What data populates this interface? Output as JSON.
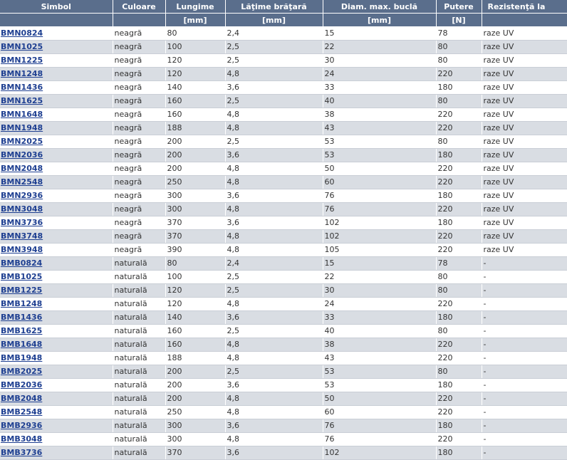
{
  "headers": {
    "simbol": "Simbol",
    "culoare": "Culoare",
    "lungime": "Lungime",
    "latime": "Lăţime brăţară",
    "diam": "Diam. max. buclă",
    "putere": "Putere",
    "rezistenta": "Rezistenţă la"
  },
  "units": {
    "simbol": "",
    "culoare": "",
    "lungime": "[mm]",
    "latime": "[mm]",
    "diam": "[mm]",
    "putere": "[N]",
    "rezistenta": ""
  },
  "rows": [
    {
      "simbol": "BMN0824",
      "culoare": "neagră",
      "lungime": "80",
      "latime": "2,4",
      "diam": "15",
      "putere": "78",
      "rezistenta": "raze UV"
    },
    {
      "simbol": "BMN1025",
      "culoare": "neagră",
      "lungime": "100",
      "latime": "2,5",
      "diam": "22",
      "putere": "80",
      "rezistenta": "raze UV"
    },
    {
      "simbol": "BMN1225",
      "culoare": "neagră",
      "lungime": "120",
      "latime": "2,5",
      "diam": "30",
      "putere": "80",
      "rezistenta": "raze UV"
    },
    {
      "simbol": "BMN1248",
      "culoare": "neagră",
      "lungime": "120",
      "latime": "4,8",
      "diam": "24",
      "putere": "220",
      "rezistenta": "raze UV"
    },
    {
      "simbol": "BMN1436",
      "culoare": "neagră",
      "lungime": "140",
      "latime": "3,6",
      "diam": "33",
      "putere": "180",
      "rezistenta": "raze UV"
    },
    {
      "simbol": "BMN1625",
      "culoare": "neagră",
      "lungime": "160",
      "latime": "2,5",
      "diam": "40",
      "putere": "80",
      "rezistenta": "raze UV"
    },
    {
      "simbol": "BMN1648",
      "culoare": "neagră",
      "lungime": "160",
      "latime": "4,8",
      "diam": "38",
      "putere": "220",
      "rezistenta": "raze UV"
    },
    {
      "simbol": "BMN1948",
      "culoare": "neagră",
      "lungime": "188",
      "latime": "4,8",
      "diam": "43",
      "putere": "220",
      "rezistenta": "raze UV"
    },
    {
      "simbol": "BMN2025",
      "culoare": "neagră",
      "lungime": "200",
      "latime": "2,5",
      "diam": "53",
      "putere": "80",
      "rezistenta": "raze UV"
    },
    {
      "simbol": "BMN2036",
      "culoare": "neagră",
      "lungime": "200",
      "latime": "3,6",
      "diam": "53",
      "putere": "180",
      "rezistenta": "raze UV"
    },
    {
      "simbol": "BMN2048",
      "culoare": "neagră",
      "lungime": "200",
      "latime": "4,8",
      "diam": "50",
      "putere": "220",
      "rezistenta": "raze UV"
    },
    {
      "simbol": "BMN2548",
      "culoare": "neagră",
      "lungime": "250",
      "latime": "4,8",
      "diam": "60",
      "putere": "220",
      "rezistenta": "raze UV"
    },
    {
      "simbol": "BMN2936",
      "culoare": "neagră",
      "lungime": "300",
      "latime": "3,6",
      "diam": "76",
      "putere": "180",
      "rezistenta": "raze UV"
    },
    {
      "simbol": "BMN3048",
      "culoare": "neagră",
      "lungime": "300",
      "latime": "4,8",
      "diam": "76",
      "putere": "220",
      "rezistenta": "raze UV"
    },
    {
      "simbol": "BMN3736",
      "culoare": "neagră",
      "lungime": "370",
      "latime": "3,6",
      "diam": "102",
      "putere": "180",
      "rezistenta": "raze UV"
    },
    {
      "simbol": "BMN3748",
      "culoare": "neagră",
      "lungime": "370",
      "latime": "4,8",
      "diam": "102",
      "putere": "220",
      "rezistenta": "raze UV"
    },
    {
      "simbol": "BMN3948",
      "culoare": "neagră",
      "lungime": "390",
      "latime": "4,8",
      "diam": "105",
      "putere": "220",
      "rezistenta": "raze UV"
    },
    {
      "simbol": "BMB0824",
      "culoare": "naturală",
      "lungime": "80",
      "latime": "2,4",
      "diam": "15",
      "putere": "78",
      "rezistenta": "-"
    },
    {
      "simbol": "BMB1025",
      "culoare": "naturală",
      "lungime": "100",
      "latime": "2,5",
      "diam": "22",
      "putere": "80",
      "rezistenta": "-"
    },
    {
      "simbol": "BMB1225",
      "culoare": "naturală",
      "lungime": "120",
      "latime": "2,5",
      "diam": "30",
      "putere": "80",
      "rezistenta": "-"
    },
    {
      "simbol": "BMB1248",
      "culoare": "naturală",
      "lungime": "120",
      "latime": "4,8",
      "diam": "24",
      "putere": "220",
      "rezistenta": "-"
    },
    {
      "simbol": "BMB1436",
      "culoare": "naturală",
      "lungime": "140",
      "latime": "3,6",
      "diam": "33",
      "putere": "180",
      "rezistenta": "-"
    },
    {
      "simbol": "BMB1625",
      "culoare": "naturală",
      "lungime": "160",
      "latime": "2,5",
      "diam": "40",
      "putere": "80",
      "rezistenta": "-"
    },
    {
      "simbol": "BMB1648",
      "culoare": "naturală",
      "lungime": "160",
      "latime": "4,8",
      "diam": "38",
      "putere": "220",
      "rezistenta": "-"
    },
    {
      "simbol": "BMB1948",
      "culoare": "naturală",
      "lungime": "188",
      "latime": "4,8",
      "diam": "43",
      "putere": "220",
      "rezistenta": "-"
    },
    {
      "simbol": "BMB2025",
      "culoare": "naturală",
      "lungime": "200",
      "latime": "2,5",
      "diam": "53",
      "putere": "80",
      "rezistenta": "-"
    },
    {
      "simbol": "BMB2036",
      "culoare": "naturală",
      "lungime": "200",
      "latime": "3,6",
      "diam": "53",
      "putere": "180",
      "rezistenta": "-"
    },
    {
      "simbol": "BMB2048",
      "culoare": "naturală",
      "lungime": "200",
      "latime": "4,8",
      "diam": "50",
      "putere": "220",
      "rezistenta": "-"
    },
    {
      "simbol": "BMB2548",
      "culoare": "naturală",
      "lungime": "250",
      "latime": "4,8",
      "diam": "60",
      "putere": "220",
      "rezistenta": "-"
    },
    {
      "simbol": "BMB2936",
      "culoare": "naturală",
      "lungime": "300",
      "latime": "3,6",
      "diam": "76",
      "putere": "180",
      "rezistenta": "-"
    },
    {
      "simbol": "BMB3048",
      "culoare": "naturală",
      "lungime": "300",
      "latime": "4,8",
      "diam": "76",
      "putere": "220",
      "rezistenta": "-"
    },
    {
      "simbol": "BMB3736",
      "culoare": "naturală",
      "lungime": "370",
      "latime": "3,6",
      "diam": "102",
      "putere": "180",
      "rezistenta": "-"
    }
  ]
}
